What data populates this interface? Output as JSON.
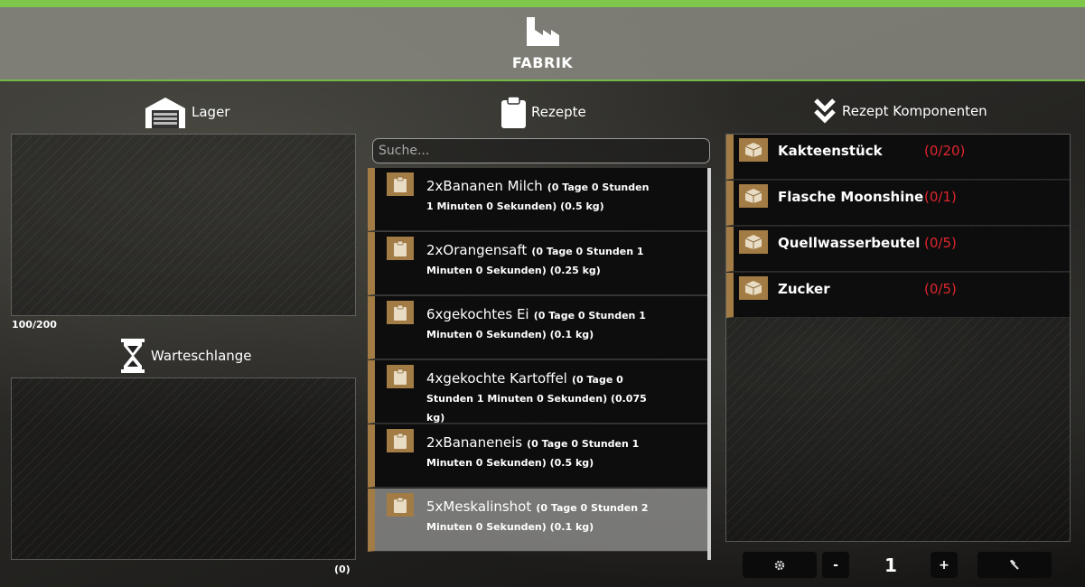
{
  "header": {
    "title": "FABRIK",
    "icon": "factory-icon"
  },
  "storage": {
    "title": "Lager",
    "icon": "warehouse-icon",
    "capacity": "100/200"
  },
  "queue": {
    "title": "Warteschlange",
    "icon": "hourglass-icon",
    "count": "(0)"
  },
  "recipes": {
    "title": "Rezepte",
    "icon": "clipboard-icon",
    "search_placeholder": "Suche...",
    "items": [
      {
        "name": "2xBananen Milch",
        "detail": "(0 Tage 0 Stunden 1 Minuten 0 Sekunden) (0.5 kg)"
      },
      {
        "name": "2xOrangensaft",
        "detail": "(0 Tage 0 Stunden 1 Minuten 0 Sekunden) (0.25 kg)"
      },
      {
        "name": "6xgekochtes Ei",
        "detail": "(0 Tage 0 Stunden 1 Minuten 0 Sekunden) (0.1 kg)"
      },
      {
        "name": "4xgekochte Kartoffel",
        "detail": "(0 Tage 0 Stunden 1 Minuten 0 Sekunden) (0.075 kg)"
      },
      {
        "name": "2xBananeneis",
        "detail": "(0 Tage 0 Stunden 1 Minuten 0 Sekunden) (0.5 kg)"
      },
      {
        "name": "5xMeskalinshot",
        "detail": "(0 Tage 0 Stunden 2 Minuten 0 Sekunden) (0.1 kg)"
      }
    ],
    "selected_index": 5
  },
  "components": {
    "title": "Rezept Komponenten",
    "icon": "double-chevron-down-icon",
    "items": [
      {
        "name": "Kakteenstück",
        "count": "(0/20)"
      },
      {
        "name": "Flasche Moonshine",
        "count": "(0/1)"
      },
      {
        "name": "Quellwasserbeutel",
        "count": "(0/5)"
      },
      {
        "name": "Zucker",
        "count": "(0/5)"
      }
    ]
  },
  "controls": {
    "settings_icon": "gear-icon",
    "minus_label": "-",
    "quantity": "1",
    "plus_label": "+",
    "hammer_icon": "hammer-icon"
  },
  "colors": {
    "accent": "#7ec74a",
    "item_brown": "#a27b45",
    "missing_red": "#e0262e"
  }
}
